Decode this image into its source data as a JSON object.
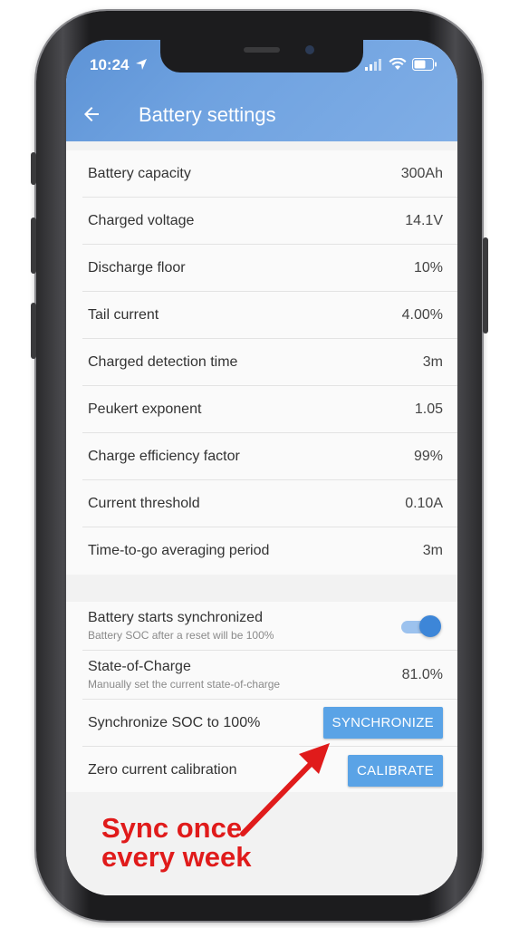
{
  "status_bar": {
    "time": "10:24"
  },
  "header": {
    "title": "Battery settings"
  },
  "settings": [
    {
      "label": "Battery capacity",
      "value": "300Ah"
    },
    {
      "label": "Charged voltage",
      "value": "14.1V"
    },
    {
      "label": "Discharge floor",
      "value": "10%"
    },
    {
      "label": "Tail current",
      "value": "4.00%"
    },
    {
      "label": "Charged detection time",
      "value": "3m"
    },
    {
      "label": "Peukert exponent",
      "value": "1.05"
    },
    {
      "label": "Charge efficiency factor",
      "value": "99%"
    },
    {
      "label": "Current threshold",
      "value": "0.10A"
    },
    {
      "label": "Time-to-go averaging period",
      "value": "3m"
    }
  ],
  "sync": {
    "starts_sync_label": "Battery starts synchronized",
    "starts_sync_sub": "Battery SOC after a reset will be 100%",
    "starts_sync_enabled": true,
    "soc_label": "State-of-Charge",
    "soc_sub": "Manually set the current state-of-charge",
    "soc_value": "81.0%",
    "sync_label": "Synchronize SOC to 100%",
    "sync_button": "SYNCHRONIZE",
    "zero_label": "Zero current calibration",
    "zero_button": "CALIBRATE"
  },
  "annotation": {
    "line1": "Sync once",
    "line2": "every week",
    "color": "#e01b1b"
  },
  "colors": {
    "accent": "#5aa3e6",
    "appbar": "#6fa2e0"
  }
}
